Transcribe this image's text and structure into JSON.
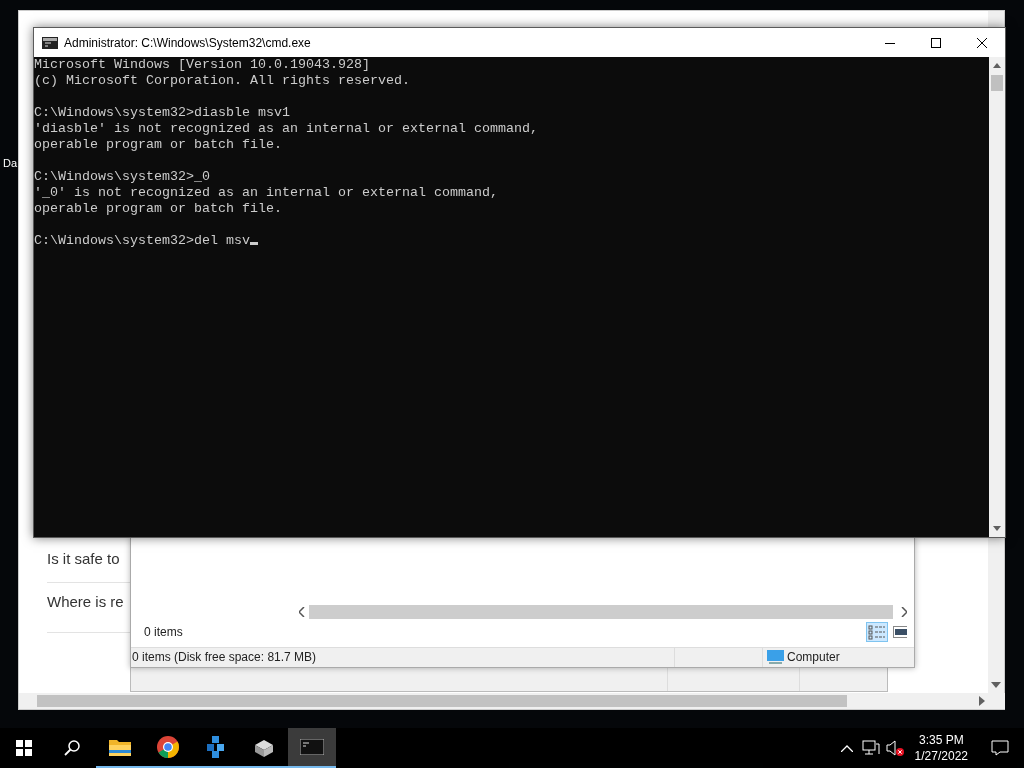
{
  "desktop": {
    "icon_label": "Da"
  },
  "browser": {
    "lines": [
      "Is it safe to ",
      "Where is re"
    ]
  },
  "explorer": {
    "content_status": "0 items",
    "views": [
      {
        "kind": "details",
        "selected": true
      },
      {
        "kind": "preview",
        "selected": false
      }
    ],
    "status_text": "0 items (Disk free space: 81.7 MB)",
    "location": "Computer"
  },
  "cmd": {
    "title": "Administrator: C:\\Windows\\System32\\cmd.exe",
    "blocks": [
      [
        "Microsoft Windows [Version 10.0.19043.928]",
        "(c) Microsoft Corporation. All rights reserved."
      ],
      [
        "C:\\Windows\\system32>diasble msv1",
        "'diasble' is not recognized as an internal or external command,",
        "operable program or batch file."
      ],
      [
        "C:\\Windows\\system32>_0",
        "'_0' is not recognized as an internal or external command,",
        "operable program or batch file."
      ],
      [
        "C:\\Windows\\system32>del msv"
      ]
    ],
    "cursor": true
  },
  "taskbar": {
    "apps": [
      {
        "kind": "folder",
        "active": false
      },
      {
        "kind": "browser",
        "active": false
      },
      {
        "kind": "cubes",
        "active": false
      },
      {
        "kind": "drive",
        "active": false
      },
      {
        "kind": "console",
        "active": true
      }
    ],
    "time": "3:35 PM",
    "date": "1/27/2022",
    "sound_muted": true
  }
}
